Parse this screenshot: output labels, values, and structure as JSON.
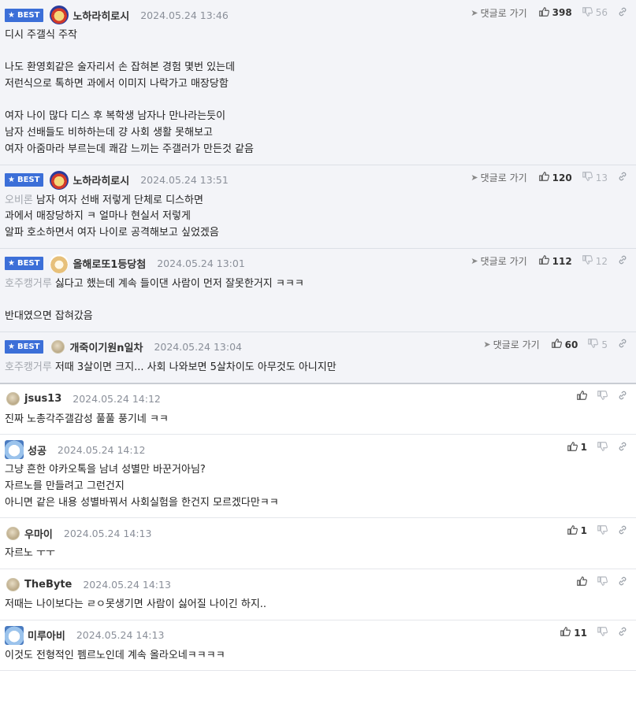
{
  "labels": {
    "best": "BEST",
    "reply": "댓글로 가기"
  },
  "comments": [
    {
      "best": true,
      "avatar": "dog-icon",
      "nick": "노하라히로시",
      "date": "2024.05.24 13:46",
      "up": "398",
      "down": "56",
      "mention": "",
      "lines": [
        "디시 주갤식 주작",
        "",
        "나도 환영회같은 술자리서 손 잡혀본 경험 몇번 있는데",
        "저런식으로 톡하면 과에서 이미지 나락가고 매장당함",
        "",
        "여자 나이 많다 디스 후 복학생 남자나 만나라는듯이",
        "남자 선배들도 비하하는데 걍 사회 생활 못해보고",
        "여자 아줌마라 부르는데 쾌감 느끼는 주갤러가 만든것 같음"
      ]
    },
    {
      "best": true,
      "avatar": "dog-icon",
      "nick": "노하라히로시",
      "date": "2024.05.24 13:51",
      "up": "120",
      "down": "13",
      "mention": "오비론",
      "lines": [
        "남자 여자 선배 저렇게 단체로 디스하면",
        "과에서 매장당하지 ㅋ 얼마나 현실서 저렇게",
        "알파 호소하면서 여자 나이로 공격해보고 싶었겠음"
      ]
    },
    {
      "best": true,
      "avatar": "fox-icon",
      "nick": "올해로또1등당첨",
      "date": "2024.05.24 13:01",
      "up": "112",
      "down": "12",
      "mention": "호주캥거루",
      "lines": [
        "싫다고 했는데 계속 들이댄 사람이 먼저 잘못한거지 ㅋㅋㅋ",
        "",
        "반대였으면 잡혀갔음"
      ]
    },
    {
      "best": true,
      "last": true,
      "avatar": "default-avatar-icon",
      "nick": "개죽이기원n일차",
      "date": "2024.05.24 13:04",
      "up": "60",
      "down": "5",
      "mention": "호주캥거루",
      "lines": [
        "저때 3살이면 크지... 사회 나와보면 5살차이도 아무것도 아니지만"
      ]
    },
    {
      "best": false,
      "avatar": "default-avatar-icon",
      "nick": "jsus13",
      "date": "2024.05.24 14:12",
      "up": "",
      "down": "",
      "mention": "",
      "lines": [
        "진짜 노총각주갤감성 풀풀 풍기네 ㅋㅋ"
      ]
    },
    {
      "best": false,
      "avatar": "polar-bear-icon",
      "nick": "성공",
      "date": "2024.05.24 14:12",
      "up": "1",
      "down": "",
      "mention": "",
      "lines": [
        "그냥 흔한 야카오톡을 남녀 성별만 바꾼거아님?",
        "자르노를 만들려고 그런건지",
        "아니면 같은 내용 성별바꿔서 사회실험을 한건지 모르겠다만ㅋㅋ"
      ]
    },
    {
      "best": false,
      "avatar": "default-avatar-icon",
      "nick": "우마이",
      "date": "2024.05.24 14:13",
      "up": "1",
      "down": "",
      "mention": "",
      "lines": [
        "자르노 ㅜㅜ"
      ]
    },
    {
      "best": false,
      "avatar": "default-avatar-icon",
      "nick": "TheByte",
      "date": "2024.05.24 14:13",
      "up": "",
      "down": "",
      "mention": "",
      "lines": [
        "저때는 나이보다는 ㄹㅇ못생기면 사람이 싫어질 나이긴 하지.."
      ]
    },
    {
      "best": false,
      "avatar": "polar-bear-icon",
      "nick": "미루아비",
      "date": "2024.05.24 14:13",
      "up": "11",
      "down": "",
      "mention": "",
      "lines": [
        "이것도 전형적인 펨르노인데 계속 올라오네ㅋㅋㅋㅋ"
      ]
    }
  ]
}
